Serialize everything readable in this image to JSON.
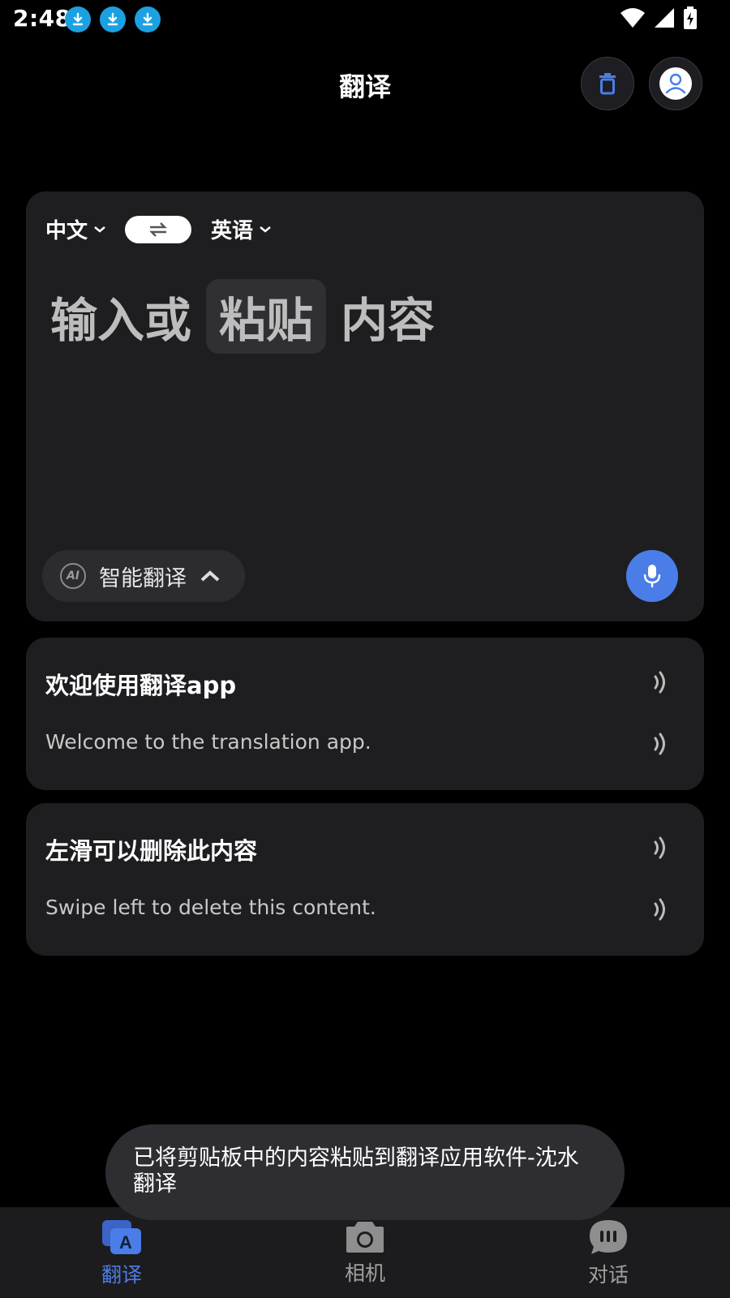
{
  "status_bar": {
    "time": "2:48",
    "notification_icons": [
      "download-icon",
      "download-icon",
      "download-icon"
    ],
    "system_icons": [
      "wifi-icon",
      "signal-icon",
      "battery-charging-icon"
    ]
  },
  "app_bar": {
    "title": "翻译",
    "actions": [
      "trash-icon",
      "profile-icon"
    ]
  },
  "translator": {
    "source_lang": "中文",
    "target_lang": "英语",
    "input_placeholder_parts": [
      "输入或",
      "粘贴",
      "内容"
    ],
    "mode_badge": "AI",
    "mode_label": "智能翻译"
  },
  "history": [
    {
      "source": "欢迎使用翻译app",
      "translation": "Welcome to the translation app."
    },
    {
      "source": "左滑可以删除此内容",
      "translation": "Swipe left to delete this content."
    }
  ],
  "toast": {
    "text": "已将剪贴板中的内容粘贴到翻译应用软件-沈水翻译"
  },
  "bottom_nav": {
    "items": [
      {
        "label": "翻译",
        "icon": "translate-icon",
        "active": true
      },
      {
        "label": "相机",
        "icon": "camera-icon",
        "active": false
      },
      {
        "label": "对话",
        "icon": "chat-icon",
        "active": false
      }
    ]
  },
  "colors": {
    "accent": "#4a7de8",
    "background": "#000000",
    "card": "#1e1e21",
    "download_badge": "#1ba1e2"
  }
}
